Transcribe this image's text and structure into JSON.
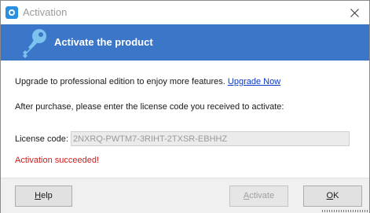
{
  "window": {
    "title": "Activation",
    "app_icon": "app-logo-icon",
    "close_icon": "close-icon"
  },
  "banner": {
    "title": "Activate the product",
    "icon": "key-icon",
    "color": "#3b76c9"
  },
  "body": {
    "upgrade_text": "Upgrade to professional edition to enjoy more features.",
    "upgrade_link": "Upgrade Now",
    "after_purchase_text": "After purchase, please enter the license code you received to activate:",
    "license_label": "License code:",
    "license_value": "2NXRQ-PWTM7-3RIHT-2TXSR-EBHHZ",
    "status_message": "Activation succeeded!",
    "status_color": "#d41818",
    "link_color": "#0b38c8"
  },
  "footer": {
    "help_button": {
      "first": "H",
      "rest": "elp"
    },
    "activate_button": {
      "first": "A",
      "rest": "ctivate",
      "disabled": true
    },
    "ok_button": {
      "first": "O",
      "rest": "K"
    }
  }
}
